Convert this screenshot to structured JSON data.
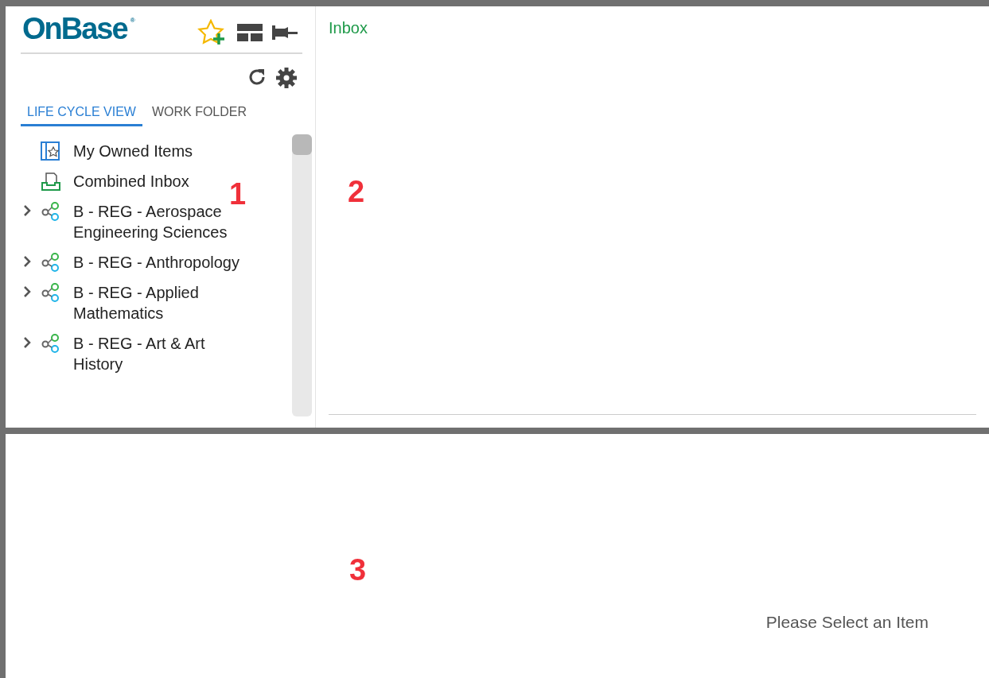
{
  "logo": {
    "text": "OnBase",
    "mark": "®"
  },
  "tabs": [
    {
      "label": "LIFE CYCLE VIEW",
      "selected": true
    },
    {
      "label": "WORK FOLDER",
      "selected": false
    }
  ],
  "tree": [
    {
      "kind": "owned",
      "label": "My Owned Items"
    },
    {
      "kind": "inbox",
      "label": "Combined Inbox"
    },
    {
      "kind": "lifecycle",
      "label": "B - REG - Aerospace Engineering Sciences",
      "expanded": false
    },
    {
      "kind": "lifecycle",
      "label": "B - REG - Anthropology",
      "expanded": false
    },
    {
      "kind": "lifecycle",
      "label": "B - REG - Applied Mathematics",
      "expanded": false
    },
    {
      "kind": "lifecycle",
      "label": "B - REG - Art & Art History",
      "expanded": false
    }
  ],
  "inbox": {
    "title": "Inbox"
  },
  "viewer": {
    "message": "Please Select an Item"
  },
  "annotations": [
    "1",
    "2",
    "3"
  ]
}
